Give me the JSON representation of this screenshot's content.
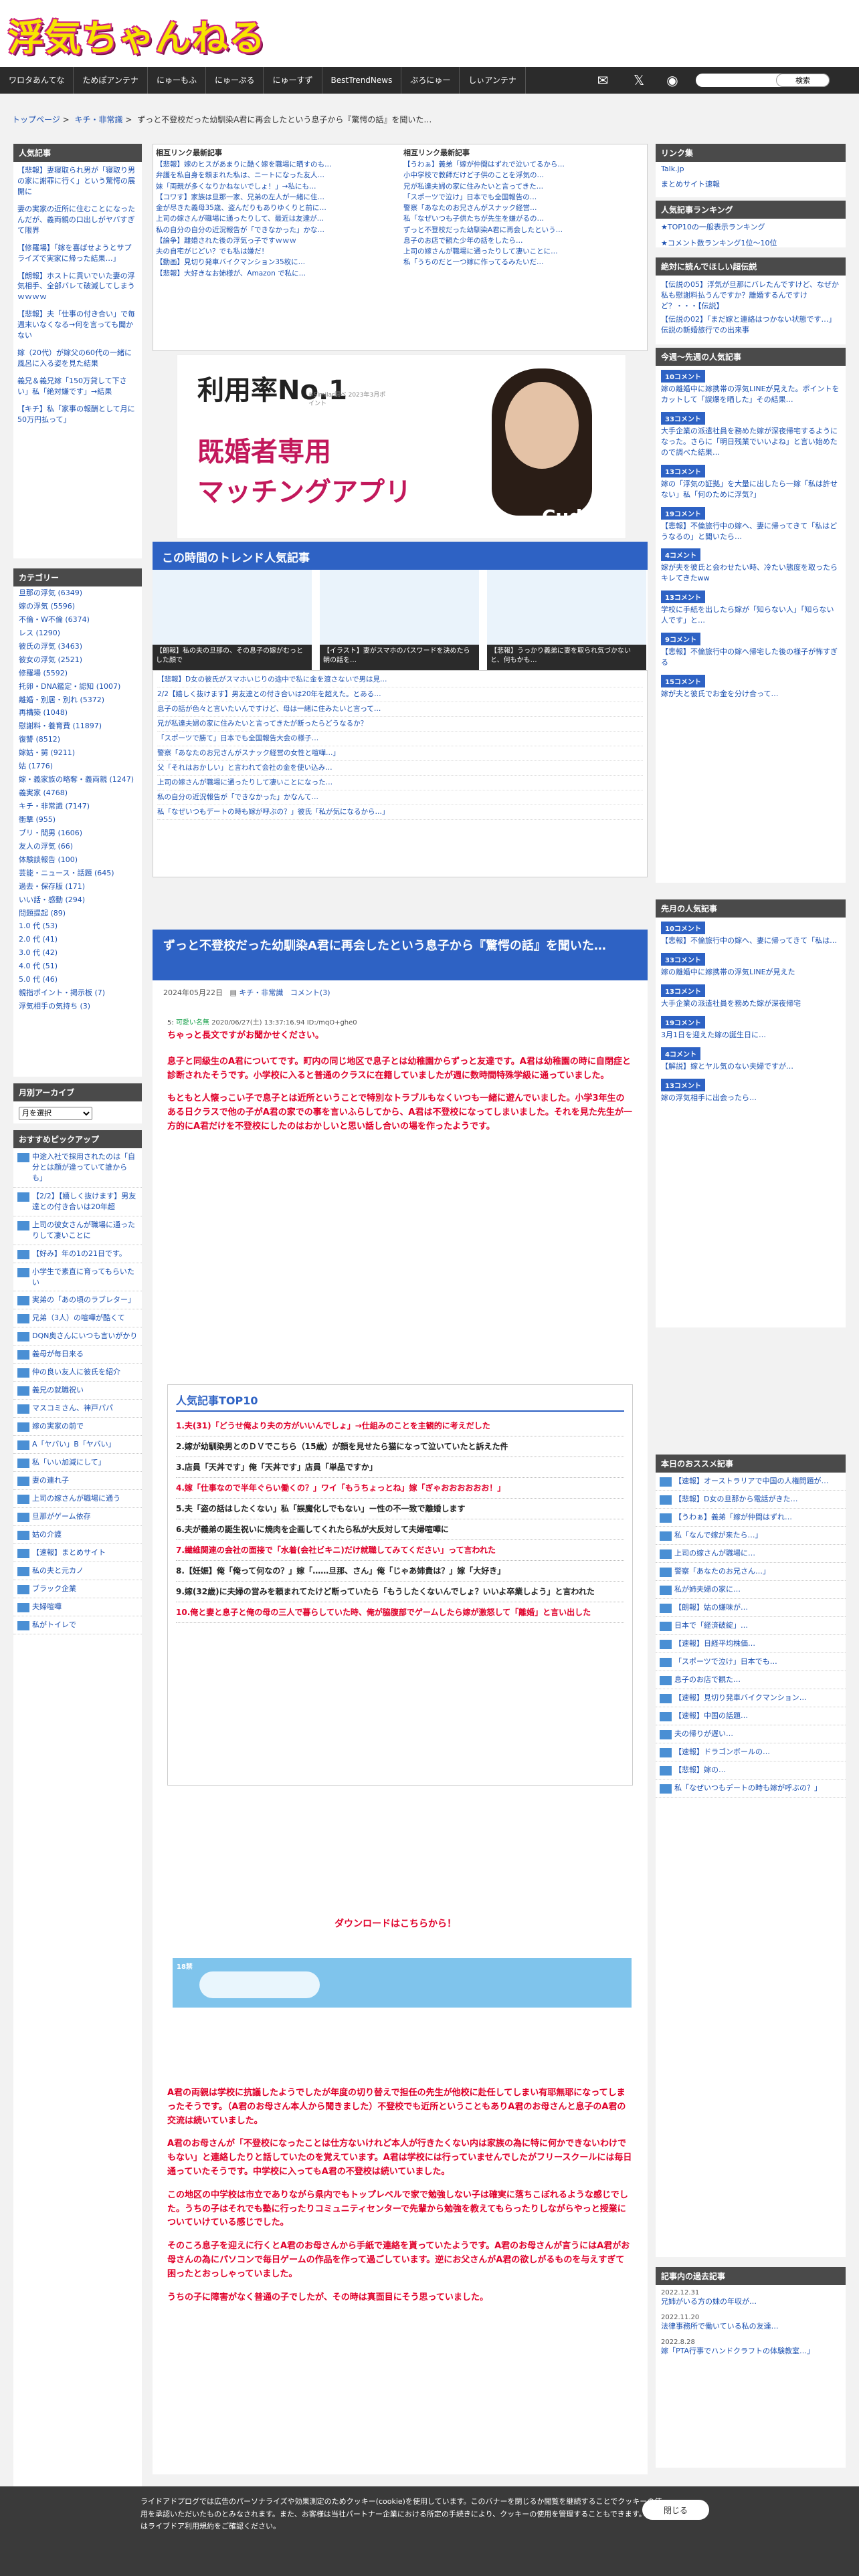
{
  "site": {
    "logo": "浮気ちゃんねる"
  },
  "nav": [
    "ワロタあんてな",
    "ためぽアンテナ",
    "にゅーもふ",
    "にゅーぷる",
    "にゅーすず",
    "BestTrendNews",
    "ぶろにゅー",
    "しぃアンテナ"
  ],
  "search": {
    "placeholder": "",
    "button": "検索"
  },
  "breadcrumb": [
    "トップページ",
    "キチ・非常識",
    "ずっと不登校だった幼馴染A君に再会したという息子から『驚愕の話』を聞いた…"
  ],
  "left_top": {
    "title": "人気記事",
    "items": [
      "【悲報】妻寝取られ男が「寝取り男の家に謝罪に行く」という驚愕の展開に",
      "妻の実家の近所に住むことになったんだが、義両親の口出しがヤバすぎて限界",
      "【修羅場】「嫁を喜ばせようとサプライズで実家に帰った結果…」",
      "【朗報】ホストに貢いでいた妻の浮気相手、全部バレて破滅してしまうｗｗｗｗ",
      "【悲報】夫「仕事の付き合い」で毎週末いなくなる→何を言っても聞かない",
      "嫁（20代）が嫁父の60代の一緒に風呂に入る姿を見た結果",
      "義兄＆義兄嫁「150万貸して下さい」私「絶対嫌です」→結果",
      "【キチ】私「家事の報酬として月に50万円払って」"
    ]
  },
  "left_cat": {
    "title": "カテゴリー",
    "items": [
      "旦那の浮気 (6349)",
      "嫁の浮気 (5596)",
      "不倫・W不倫 (6374)",
      "レス (1290)",
      "彼氏の浮気 (3463)",
      "彼女の浮気 (2521)",
      "修羅場 (5592)",
      "托卵・DNA鑑定・認知 (1007)",
      "離婚・別居・別れ (5372)",
      "再構築 (1048)",
      "慰謝料・養育費 (11897)",
      "復讐 (8512)",
      "嫁姑・舅 (9211)",
      "姑 (1776)",
      "嫁・義家族の略奪・義両親 (1247)",
      "義実家 (4768)",
      "キチ・非常識 (7147)",
      "衝撃 (955)",
      "ブリ・間男 (1606)",
      "友人の浮気 (66)",
      "体験談報告 (100)",
      "芸能・ニュース・話題 (645)",
      "過去・保存版 (171)",
      "いい話・感動 (294)",
      "問題提起 (89)",
      "1.0 代 (53)",
      "2.0 代 (41)",
      "3.0 代 (42)",
      "4.0 代 (51)",
      "5.0 代 (46)",
      "親指ポイント・掲示板 (7)",
      "浮気相手の気持ち (3)"
    ]
  },
  "left_arc": {
    "title": "月別アーカイブ",
    "select": "月を選択"
  },
  "left_rec": {
    "title": "おすすめピックアップ",
    "items": [
      "中途入社で採用されたのは「自分とは顔が違っていて誰からも」",
      "【2/2】【嬉しく抜けます】男友達との付き合いは20年超",
      "上司の彼女さんが職場に通ったりして凄いことに",
      "【好み】年の1の21日です。",
      "小学生で素直に育ってもらいたい",
      "実弟の「あの頃のラブレター」",
      "兄弟（3人）の喧嘩が酷くて",
      "DQN奥さんにいつも言いがかり",
      "義母が毎日来る",
      "仲の良い友人に彼氏を紹介",
      "義兄の就職祝い",
      "マスコミさん、神戸パパ",
      "嫁の実家の前で",
      "A「ヤバい」B「ヤバい」",
      "私「いい加減にして」",
      "妻の連れ子",
      "上司の嫁さんが職場に通う",
      "旦那がゲーム依存",
      "姑の介護",
      "【速報】まとめサイト",
      "私の夫と元カノ",
      "ブラック企業",
      "夫婦喧嘩",
      "私がトイレで"
    ]
  },
  "antenna": {
    "left_title": "相互リンク最新記事",
    "right_title": "相互リンク最新記事",
    "left": [
      "【悲報】嫁のヒスがあまりに酷く嫁を職場に晒すのも…",
      "弁護を私自身を頼まれた私は、ニートになった友人…",
      "妹「両親が多くなりかねないでしょ！」→私にも…",
      "【コワす】家族は旦那一家、兄弟の左人が一緒に住…",
      "金が尽きた義母35歳、盗んだりもありゆくりと前に…",
      "上司の嫁さんが職場に通ったりして、最近は友達が…",
      "私の自分の自分の近況報告が「できなかった」かな…",
      "【論争】離婚された後の浮気っ子ですｗｗｗ",
      "夫の自宅がじどい？でも私は嫌だ！",
      "【動画】見切り発車バイクマンション35枚に…",
      "【悲報】大好きなお姉様が、Amazon で私に…"
    ],
    "right": [
      "【うわぁ】義弟「嫁が仲間はずれで泣いてるから…",
      "小中学校で教師だけど子供のことを浮気の…",
      "兄が私達夫婦の家に住みたいと言ってきた…",
      "「スポーツで泣け」日本でも全国報告の…",
      "警察「あなたのお兄さんがスナック経営…",
      "私「なぜいつも子供たちが先生を嫌がるの…",
      "ずっと不登校だった幼馴染A君に再会したという…",
      "息子のお店で観た少年の話をしたら…",
      "上司の嫁さんが職場に通ったりして凄いことに…",
      "私「うちのだと一つ嫁に作ってるみたいだ…"
    ]
  },
  "ad": {
    "big": "利用率No.1",
    "note": "※Similar調べ 2023年3月ポイント",
    "line1": "既婚者専用",
    "line2": "マッチングアプリ",
    "brand": "Cuddle"
  },
  "trend": {
    "title": "この時間のトレンド人気記事",
    "cards": [
      "【朗報】私の夫の旦那の、その息子の嫁がむっとした顔で",
      "【イラスト】妻がスマホのパスワードを決めたら朝の話を…",
      "【悲報】うっかり義弟に妻を取られ気づかないと、何もかも…"
    ],
    "list": [
      "【悲報】D女の彼氏がスマホいじりの途中で私に金を渡さないで男は見…",
      "2/2【嬉しく抜けます】男友達との付き合いは20年を超えた。とある…",
      "息子の話が色々と言いたいんですけど、母は一緒に住みたいと言って…",
      "兄が私達夫婦の家に住みたいと言ってきたが断ったらどうなるか？",
      "「スポーツで勝て」日本でも全国報告大会の様子…",
      "警察「あなたのお兄さんがスナック経営の女性と喧嘩…」",
      "父「それはおかしい」と言われて会社の金を使い込み…",
      "上司の嫁さんが職場に通ったりして凄いことになった…",
      "私の自分の近況報告が「できなかった」かなんて…",
      "私「なぜいつもデートの時も嫁が呼ぶの？」彼氏「私が気になるから…」"
    ]
  },
  "article": {
    "title": "ずっと不登校だった幼馴染A君に再会したという息子から『驚愕の話』を聞いた…",
    "date": "2024年05月22日",
    "cat": "キチ・非常識",
    "comments": "コメント(3)",
    "res_no": "5",
    "res_name": "可愛い名無",
    "res_date": "2020/06/27(土) 13:37:16.94 ID:/mqO+ghe0",
    "p1": "ちゃっと長文ですがお聞かせください。",
    "p2": "息子と同級生のA君についてです。町内の同じ地区で息子とは幼稚園からずっと友達です。A君は幼稚園の時に自閉症と診断されたそうです。小学校に入ると普通のクラスに在籍していましたが週に数時間特殊学級に通っていました。",
    "p3": "もともと人懐っこい子で息子とは近所ということで特別なトラブルもなくいつも一緒に遊んでいました。小学3年生のある日クラスで他の子がA君の家での事を言いふらしてから、A君は不登校になってしまいました。それを見た先生が一方的にA君だけを不登校にしたのはおかしいと思い話し合いの場を作ったようです。",
    "top10_title": "人気記事TOP10",
    "top10": [
      "1.夫(31)「どうせ俺より夫の方がいいんでしょ」→仕組みのことを主観的に考えだした",
      "2.嫁が幼馴染男とのＤＶでこちら（15歳）が顔を見せたら猫になって泣いていたと訴えた件",
      "3.店員「天丼です」俺「天丼です」店員「単品ですか」",
      "4.嫁「仕事なので半年ぐらい働くの？」ワイ「もうちょっとね」嫁「ぎゃおおおおおお！」",
      "5.夫「盗の話はしたくない」私「誤魔化しでもない」ー性の不一致で離婚します",
      "6.夫が義弟の誕生祝いに焼肉を企画してくれたら私が大反対して夫婦喧嘩に",
      "7.繊維関連の会社の面接で「水着(会社ビキニ)だけ就職してみてください」って言われた",
      "8.【妊娠】俺「俺って何なの？」嫁「……旦那、さん」俺「じゃあ姉貴は？」嫁「大好き」",
      "9.嫁(32歳)に夫婦の営みを頼まれてたけど断っていたら「もうしたくないんでしょ？いいよ卒業しよう」と言われた",
      "10.俺と妻と息子と俺の母の三人で暮らしていた時、俺が脇腹部でゲームしたら嫁が激怒して「離婚」と言い出した"
    ],
    "dl": "ダウンロードはこちらから！",
    "banner_tag": "18禁",
    "p4": "A君の両親は学校に抗議したようでしたが年度の切り替えで担任の先生が他校に赴任してしまい有耶無耶になってしまったそうです。（A君のお母さん本人から聞きました）不登校でも近所ということもありA君のお母さんと息子のA君の交流は続いていました。",
    "p5": "A君のお母さんが「不登校になったことは仕方ないけれど本人が行きたくない内は家族の為に特に何かできないわけでもない」と連絡したりと話していたのを覚えています。A君は学校には行っていませんでしたがフリースクールには毎日通っていたそうです。中学校に入ってもA君の不登校は続いていました。",
    "p6": "この地区の中学校は市立でありながら県内でもトップレベルで家で勉強しない子は確実に落ちこぼれるような感じでした。うちの子はそれでも塾に行ったりコミュニティセンターで先輩から勉強を教えてもらったりしながらやっと授業についていけている感じでした。",
    "p7": "そのころ息子を迎えに行くとA君のお母さんから手紙で連絡を貰っていたようです。A君のお母さんが言うにはA君がお母さんの為にパソコンで毎日ゲームの作品を作って過ごしています。逆にお父さんがA君の欲しがるものを与えすぎて困ったとおっしゃっていました。",
    "p8": "うちの子に障害がなく普通の子でしたが、その時は真面目にそう思っていました。"
  },
  "right": {
    "link_title": "リンク集",
    "links": [
      "Talk.jp",
      "まとめサイト速報"
    ],
    "rank_title": "人気記事ランキング",
    "rank": [
      "★TOP10の一般表示ランキング",
      "★コメント数ランキング1位〜10位"
    ],
    "war_title": "絶対に読んでほしい超伝説",
    "war": "【伝説の05】浮気が旦那にバレたんですけど、なぜか私も慰謝料払うんですか？離婚するんですけど？・・・【伝説】",
    "war2": "【伝説の02】「まだ嫁と連絡はつかない状態です…」伝説の新婚旅行での出来事",
    "today_title": "今週〜先週の人気記事",
    "today_tags": [
      "10コメント",
      "33コメント",
      "13コメント",
      "19コメント",
      "4コメント",
      "13コメント",
      "9コメント",
      "15コメント"
    ],
    "today": [
      "嫁の離婚中に嫁携帯の浮気LINEが見えた。ポイントをカットして「誤爆を晒した」その結果…",
      "大手企業の派遣社員を務めた嫁が深夜帰宅するようになった。さらに「明日残業でいいよね」と言い始めたので調べた結果…",
      "嫁の「浮気の証拠」を大量に出したら一嫁「私は許せない」私「何のために浮気?」",
      "【悲報】不倫旅行中の嫁へ、妻に帰ってきて「私はどうなるの」と聞いたら…",
      "嫁が夫を彼氏と会わせたい時、冷たい態度を取ったらキレてきたww",
      "学校に手紙を出したら嫁が「知らない人」「知らない人です」と…",
      "【悲報】不倫旅行中の嫁へ帰宅した後の様子が怖すぎる",
      "嫁が夫と彼氏でお金を分け合って…"
    ],
    "month_title": "先月の人気記事",
    "month": [
      "【悲報】不倫旅行中の嫁へ、妻に帰ってきて「私は…",
      "嫁の離婚中に嫁携帯の浮気LINEが見えた",
      "大手企業の派遣社員を務めた嫁が深夜帰宅",
      "3月1日を迎えた嫁の誕生日に…",
      "【解説】嫁とヤル気のない夫婦ですが…",
      "嫁の浮気相手に出会ったら…"
    ],
    "pick_title": "本日のおススメ記事",
    "pick": [
      "【速報】オーストラリアで中国の人権問題が…",
      "【悲報】D女の旦那から電話がきた…",
      "【うわぁ】義弟「嫁が仲間はずれ…",
      "私「なんで嫁が来たら…」",
      "上司の嫁さんが職場に…",
      "警察「あなたのお兄さん…」",
      "私が姉夫婦の家に…",
      "【朗報】姑の嫌味が…",
      "日本で「経済破綻」…",
      "【速報】日経平均株価…",
      "「スポーツで泣け」日本でも…",
      "息子のお店で観た…",
      "【速報】見切り発車バイクマンション…",
      "【速報】中国の話題…",
      "夫の帰りが遅い…",
      "【速報】ドラゴンボールの…",
      "【悲報】嫁の…",
      "私「なぜいつもデートの時も嫁が呼ぶの？」"
    ],
    "hist_title": "記事内の過去記事",
    "hist": [
      {
        "d": "2022.12.31",
        "t": "兄姉がいる方の妹の年収が…"
      },
      {
        "d": "2022.11.20",
        "t": "法律事務所で働いている私の友達…"
      },
      {
        "d": "2022.8.28",
        "t": "嫁「PTA行事でハンドクラフトの体験教室…」"
      }
    ]
  },
  "cookie": {
    "text": "ライドアドプログでは広告のパーソナライズや効果測定のためクッキー(cookie)を使用しています。このバナーを閉じるか閲覧を継続することでクッキーの使用を承認いただいたものとみなされます。また、お客様は当社パートナー企業における所定の手続きにより、クッキーの使用を管理することもできます。詳細はライブドア利用規約をご確認ください。",
    "button": "閉じる"
  }
}
